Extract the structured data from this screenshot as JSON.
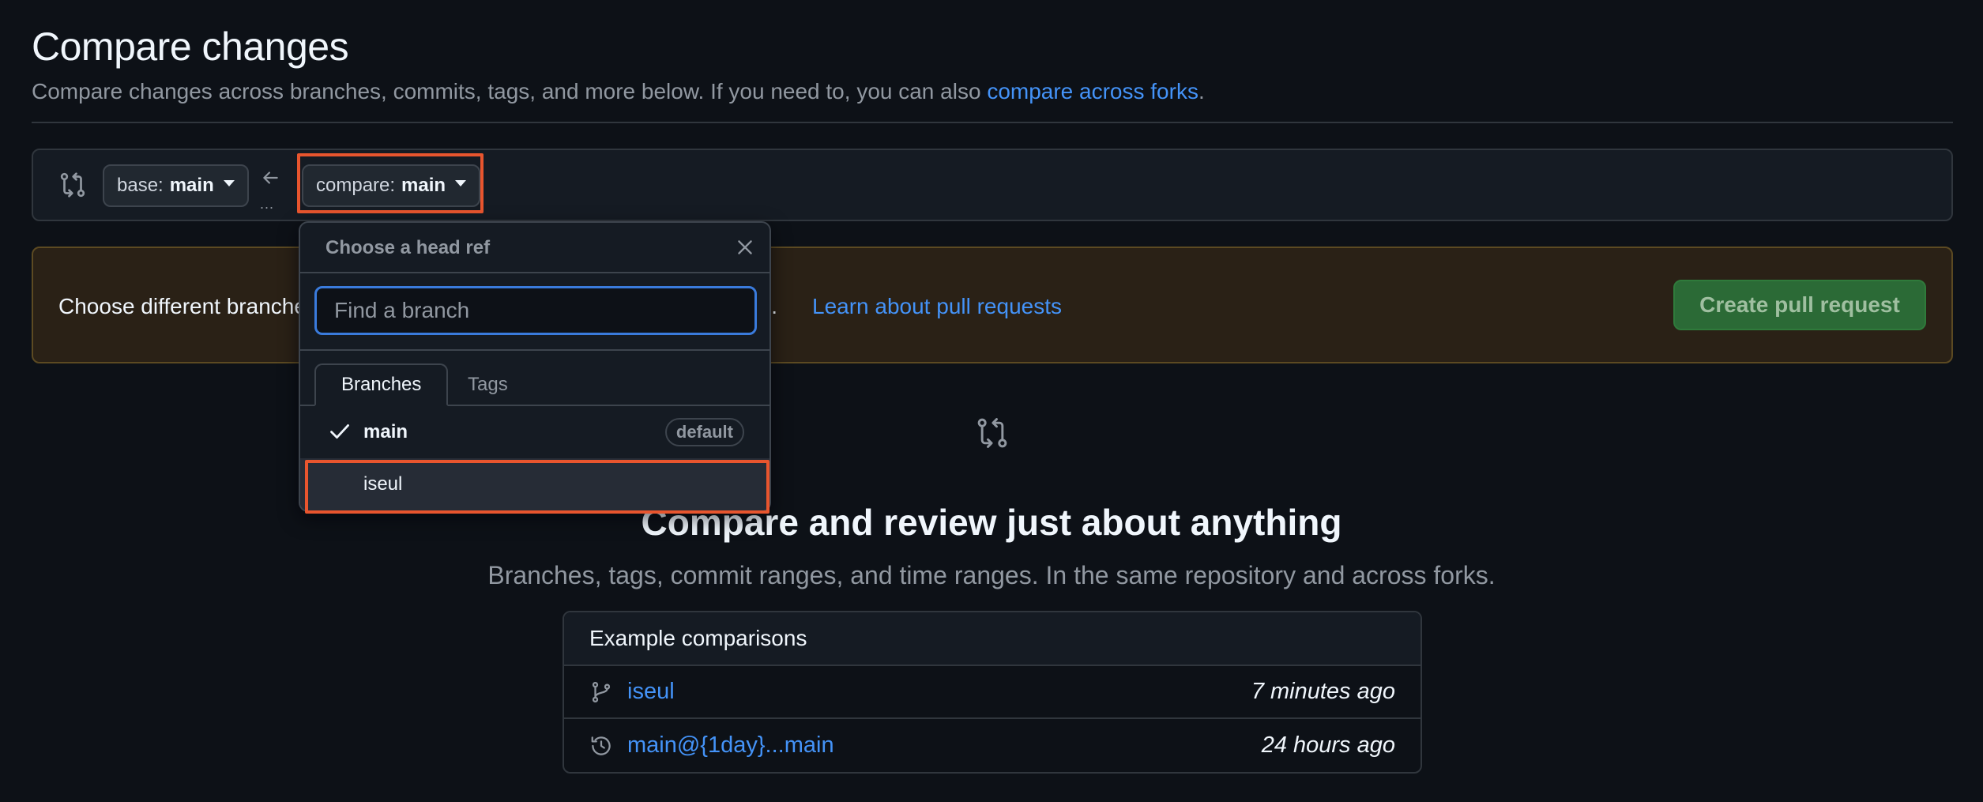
{
  "header": {
    "title": "Compare changes",
    "subtitle": "Compare changes across branches, commits, tags, and more below. If you need to, you can also",
    "subtitle_link": "compare across forks",
    "subtitle_end": "."
  },
  "range": {
    "base_prefix": "base:",
    "base_branch": "main",
    "compare_prefix": "compare:",
    "compare_branch": "main",
    "dots": "..."
  },
  "notice": {
    "text": "Choose different branches or forks above to discuss and review changes.",
    "link": "Learn about pull requests",
    "create_button": "Create pull request"
  },
  "blank_state": {
    "title": "Compare and review just about anything",
    "subtitle": "Branches, tags, commit ranges, and time ranges. In the same repository and across forks."
  },
  "examples": {
    "heading": "Example comparisons",
    "rows": [
      {
        "icon": "git-branch-icon",
        "label": "iseul",
        "time": "7 minutes ago"
      },
      {
        "icon": "history-icon",
        "label": "main@{1day}...main",
        "time": "24 hours ago"
      }
    ]
  },
  "dropdown": {
    "title": "Choose a head ref",
    "filter_placeholder": "Find a branch",
    "tabs": [
      "Branches",
      "Tags"
    ],
    "items": [
      {
        "name": "main",
        "badge": "default",
        "selected": true
      },
      {
        "name": "iseul",
        "badge": "",
        "selected": false
      }
    ]
  },
  "colors": {
    "background": "#0d1117",
    "link": "#4493f8",
    "highlight": "#e8552e",
    "create_button": "#2b6a36"
  }
}
